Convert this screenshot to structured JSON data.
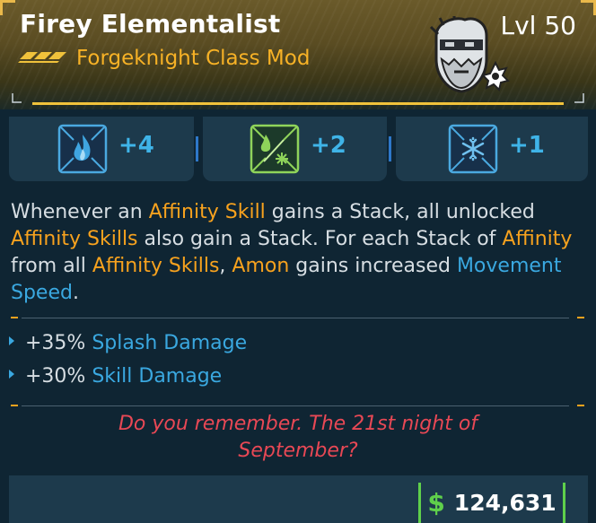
{
  "header": {
    "item_name": "Firey Elementalist",
    "level": "Lvl 50",
    "item_type": "Forgeknight Class Mod",
    "rarity_icon": "legendary-chevrons-icon",
    "portrait_icon": "amon-portrait-icon",
    "accent_color": "#f0c23b"
  },
  "skills": [
    {
      "icon": "fire-skill-icon",
      "value": "+4"
    },
    {
      "icon": "fire-frost-skill-icon",
      "value": "+2"
    },
    {
      "icon": "frost-skill-icon",
      "value": "+1"
    }
  ],
  "description": {
    "p1": "Whenever an ",
    "k1": "Affinity Skill",
    "p2": " gains a Stack, all unlocked ",
    "k2": "Affinity Skills",
    "p3": " also gain a Stack. For each Stack of ",
    "k3": "Affinity",
    "p4": " from all ",
    "k4": "Affinity Skills",
    "p5": ", ",
    "k5": "Amon",
    "p6": " gains increased ",
    "k6": "Movement Speed",
    "p7": "."
  },
  "bonuses": [
    {
      "value": "+35%",
      "stat": "Splash Damage"
    },
    {
      "value": "+30%",
      "stat": "Skill Damage"
    }
  ],
  "flavor_text": {
    "line1": "Do you remember. The 21st night of",
    "line2": "September?"
  },
  "footer": {
    "currency_symbol": "$",
    "price": "124,631",
    "price_color": "#5fd04b"
  }
}
